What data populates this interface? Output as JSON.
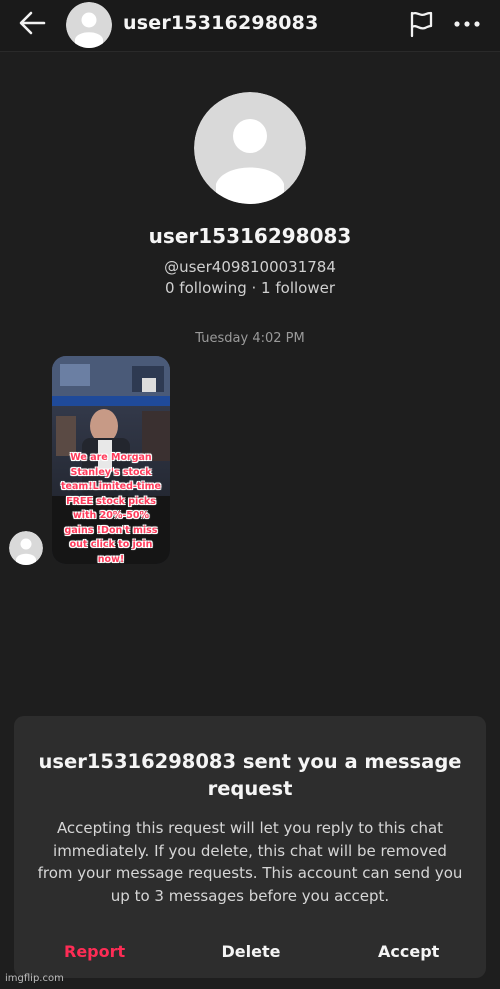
{
  "header": {
    "username": "user15316298083",
    "back_icon": "back-arrow-icon",
    "report_icon": "flag-icon",
    "more_icon": "more-dots-icon"
  },
  "profile": {
    "name": "user15316298083",
    "handle": "@user4098100031784",
    "stats": "0 following · 1 follower"
  },
  "conversation": {
    "timestamp": "Tuesday 4:02 PM",
    "message_card_text": "We are Morgan Stanley's stock team!Limited-time FREE stock picks with 20%-50% gains !Don't miss out click to join now!"
  },
  "request": {
    "title": "user15316298083 sent you a message request",
    "body": "Accepting this request will let you reply to this chat immediately. If you delete, this chat will be removed from your message requests. This account can send you up to 3 messages before you accept.",
    "report_label": "Report",
    "delete_label": "Delete",
    "accept_label": "Accept"
  },
  "colors": {
    "report": "#fe2c55",
    "background": "#1e1e1e",
    "sheet": "#2d2d2d"
  },
  "watermark": "imgflip.com"
}
